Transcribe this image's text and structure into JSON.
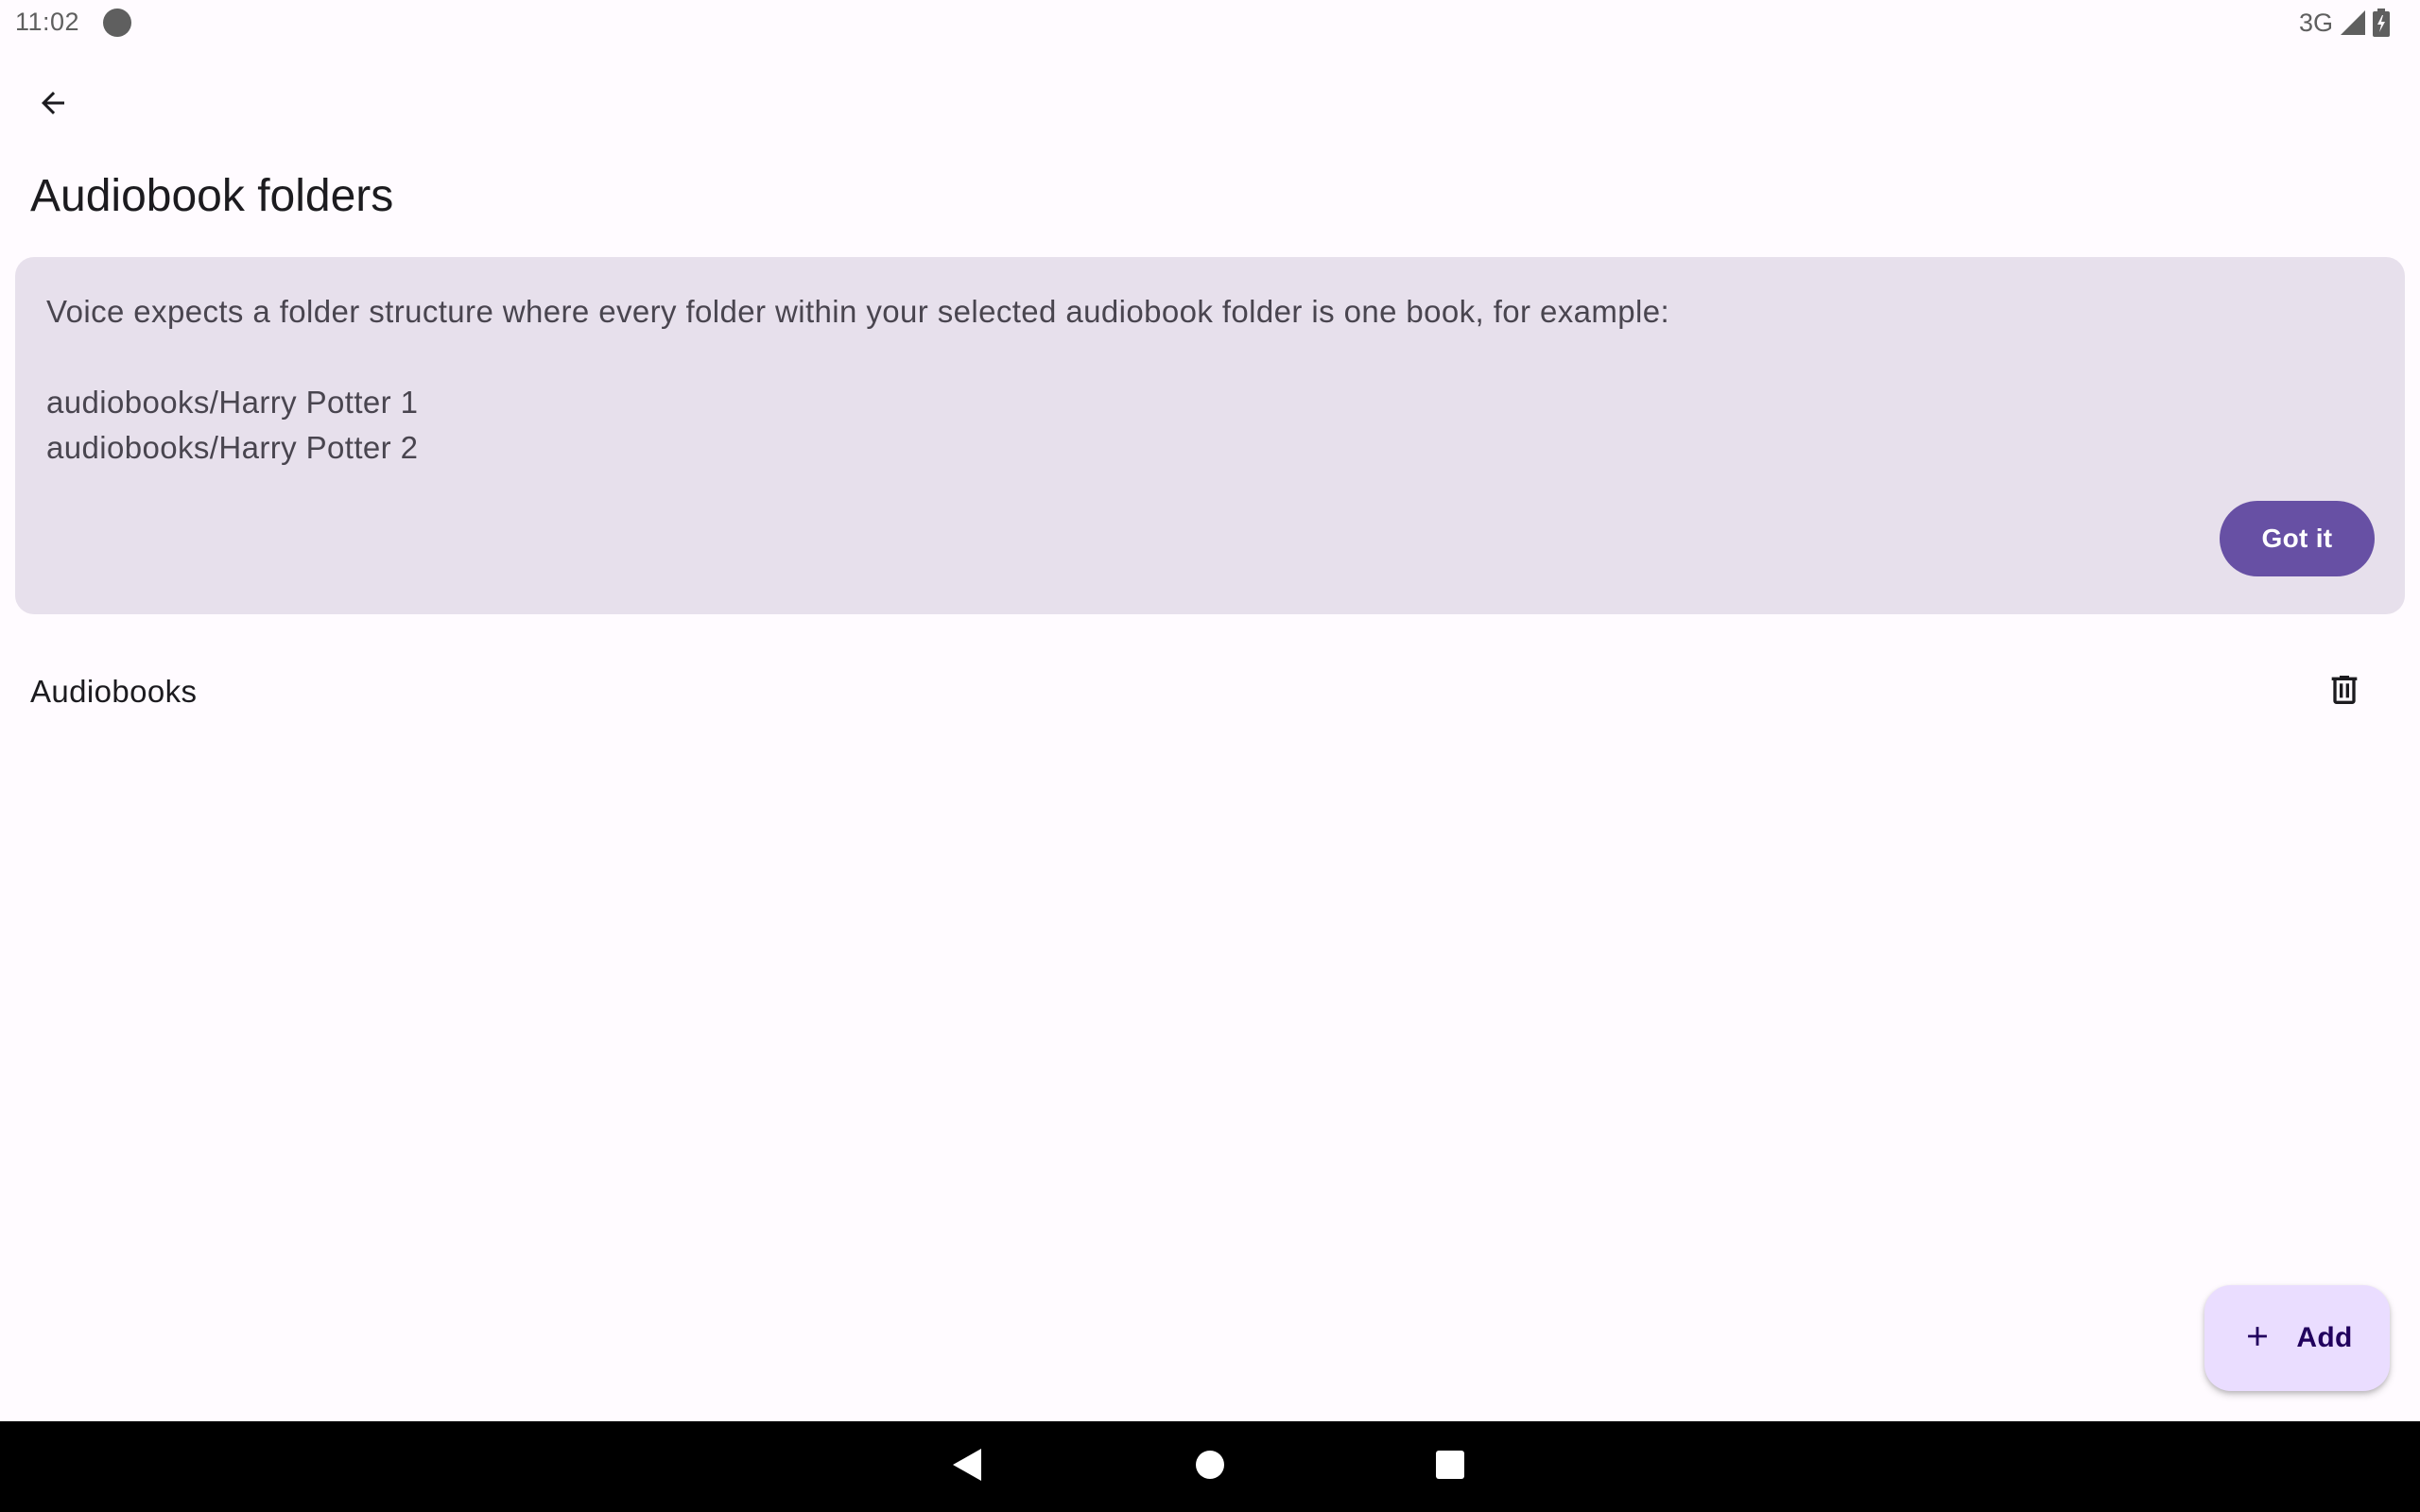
{
  "status_bar": {
    "time": "11:02",
    "network": "3G",
    "icons": [
      "notification-dot-icon",
      "signal-icon",
      "battery-icon"
    ]
  },
  "app_bar": {
    "back_icon": "arrow-back-icon",
    "title": "Audiobook folders"
  },
  "info_card": {
    "message": "Voice expects a folder structure where every folder within your selected audiobook folder is one book, for example:",
    "examples": [
      "audiobooks/Harry Potter 1",
      "audiobooks/Harry Potter 2"
    ],
    "button_label": "Got it"
  },
  "folders": [
    {
      "name": "Audiobooks",
      "action_icon": "delete-icon"
    }
  ],
  "fab": {
    "icon": "plus-icon",
    "label": "Add"
  },
  "nav_bar": {
    "buttons": [
      "nav-back-icon",
      "nav-home-icon",
      "nav-recents-icon"
    ]
  },
  "colors": {
    "background": "#fffbff",
    "card": "#e7e0ec",
    "primary": "#6750a4",
    "fab_container": "#eaddff",
    "on_fab": "#21005d",
    "text_secondary": "#49454f"
  }
}
